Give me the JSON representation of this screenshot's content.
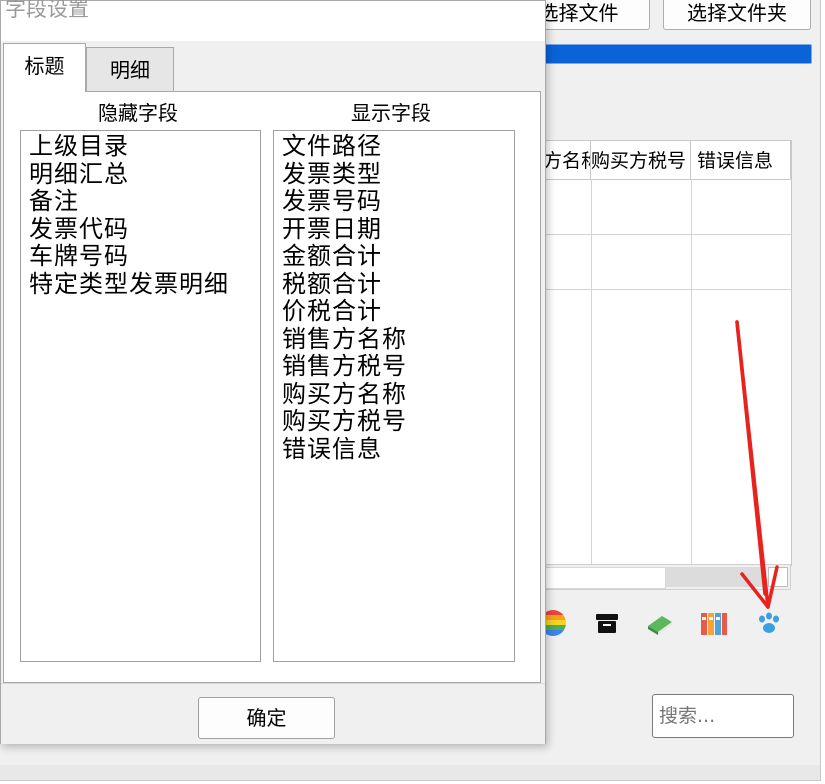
{
  "main_window": {
    "buttons": {
      "select_file": "选择文件",
      "select_folder": "选择文件夹"
    },
    "progress_percent": 100,
    "grid": {
      "columns": [
        "方名称",
        "购买方税号",
        "错误信息"
      ],
      "rows": []
    },
    "toolbar_icons": [
      "pie-chart-icon",
      "archive-box-icon",
      "green-book-icon",
      "binders-icon",
      "paw-print-icon"
    ],
    "search": {
      "placeholder": "搜索..."
    }
  },
  "dialog": {
    "title": "字段设置",
    "tabs": [
      {
        "label": "标题",
        "selected": true
      },
      {
        "label": "明细",
        "selected": false
      }
    ],
    "hidden_fields_label": "隐藏字段",
    "shown_fields_label": "显示字段",
    "hidden_fields": [
      "上级目录",
      "明细汇总",
      "备注",
      "发票代码",
      "车牌号码",
      "特定类型发票明细"
    ],
    "shown_fields": [
      "文件路径",
      "发票类型",
      "发票号码",
      "开票日期",
      "金额合计",
      "税额合计",
      "价税合计",
      "销售方名称",
      "销售方税号",
      "购买方名称",
      "购买方税号",
      "错误信息"
    ],
    "ok_label": "确定"
  },
  "colors": {
    "progress": "#0a64d8",
    "annotation_arrow": "#e8231f"
  }
}
